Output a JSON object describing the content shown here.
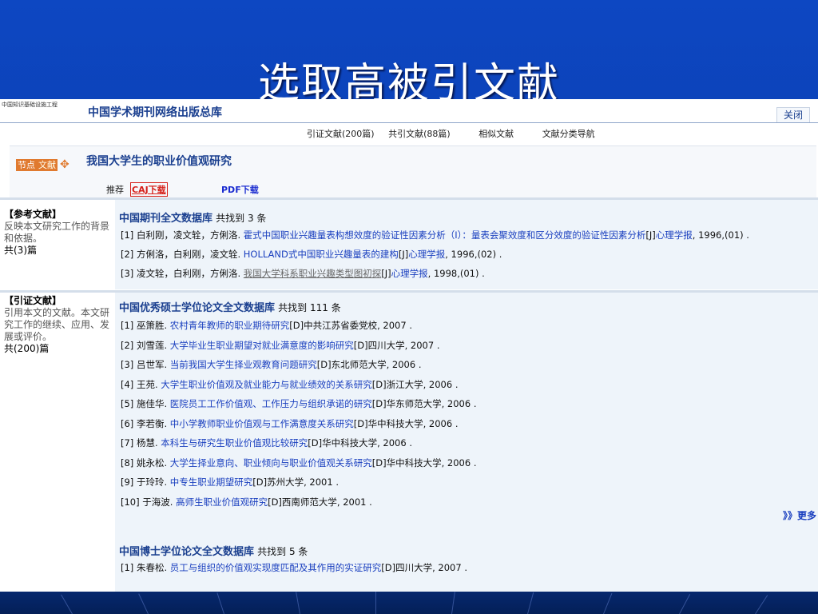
{
  "slide": {
    "title": "选取高被引文献"
  },
  "header": {
    "logo_text": "中国知识基础设施工程",
    "site_name": "中国学术期刊网络出版总库",
    "close_label": "关闭"
  },
  "nav": {
    "citing": "引证文献(200篇)",
    "co_citing": "共引文献(88篇)",
    "similar": "相似文献",
    "category": "文献分类导航"
  },
  "article": {
    "logo_a": "节点",
    "logo_b": "文献",
    "title": "我国大学生的职业价值观研究",
    "recommend": "推荐",
    "caj": "CAJ下载",
    "pdf": "PDF下载"
  },
  "references": {
    "side_heading": "【参考文献】",
    "side_desc": "反映本文研究工作的背景和依据。",
    "side_count": "共(3)篇",
    "db_name": "中国期刊全文数据库",
    "db_count": "共找到 3 条",
    "items": [
      {
        "idx": "[1]",
        "authors": "白利刚，凌文辁，方俐洛.",
        "title": "霍式中国职业兴趣量表构想效度的验证性因素分析（Ⅰ）：量表会聚效度和区分效度的验证性因素分析",
        "type": "[J]",
        "journal": "心理学报",
        "tail": ", 1996,(01) ."
      },
      {
        "idx": "[2]",
        "authors": "方俐洛，白利刚，凌文辁.",
        "title": "HOLLAND式中国职业兴趣量表的建构",
        "type": "[J]",
        "journal": "心理学报",
        "tail": ", 1996,(02) ."
      },
      {
        "idx": "[3]",
        "authors": "凌文辁，白利刚，方俐洛.",
        "title": "我国大学科系职业兴趣类型图初探",
        "type": "[J]",
        "journal": "心理学报",
        "tail": ", 1998,(01) ."
      }
    ]
  },
  "citations": {
    "side_heading": "【引证文献】",
    "side_desc": "引用本文的文献。本文研究工作的继续、应用、发展或评价。",
    "side_count": "共(200)篇",
    "master": {
      "db_name": "中国优秀硕士学位论文全文数据库",
      "db_count": "共找到 111 条",
      "items": [
        {
          "idx": "[1]",
          "authors": "巫箫胜.",
          "title": "农村青年教师的职业期待研究",
          "rest": "[D]中共江苏省委党校, 2007 ."
        },
        {
          "idx": "[2]",
          "authors": "刘雪莲.",
          "title": "大学毕业生职业期望对就业满意度的影响研究",
          "rest": "[D]四川大学, 2007 ."
        },
        {
          "idx": "[3]",
          "authors": "吕世军.",
          "title": "当前我国大学生择业观教育问题研究",
          "rest": "[D]东北师范大学, 2006 ."
        },
        {
          "idx": "[4]",
          "authors": "王苑.",
          "title": "大学生职业价值观及就业能力与就业绩效的关系研究",
          "rest": "[D]浙江大学, 2006 ."
        },
        {
          "idx": "[5]",
          "authors": "施佳华.",
          "title": "医院员工工作价值观、工作压力与组织承诺的研究",
          "rest": "[D]华东师范大学, 2006 ."
        },
        {
          "idx": "[6]",
          "authors": "李若衡.",
          "title": "中小学教师职业价值观与工作满意度关系研究",
          "rest": "[D]华中科技大学, 2006 ."
        },
        {
          "idx": "[7]",
          "authors": "杨慧.",
          "title": "本科生与研究生职业价值观比较研究",
          "rest": "[D]华中科技大学, 2006 ."
        },
        {
          "idx": "[8]",
          "authors": "姚永松.",
          "title": "大学生择业意向、职业倾向与职业价值观关系研究",
          "rest": "[D]华中科技大学, 2006 ."
        },
        {
          "idx": "[9]",
          "authors": "于玲玲.",
          "title": "中专生职业期望研究",
          "rest": "[D]苏州大学, 2001 ."
        },
        {
          "idx": "[10]",
          "authors": "于海波.",
          "title": "高师生职业价值观研究",
          "rest": "[D]西南师范大学, 2001 ."
        }
      ],
      "more": "》》更多"
    },
    "doctor": {
      "db_name": "中国博士学位论文全文数据库",
      "db_count": "共找到 5 条",
      "items": [
        {
          "idx": "[1]",
          "authors": "朱春松.",
          "title": "员工与组织的价值观实现度匹配及其作用的实证研究",
          "rest": "[D]四川大学, 2007 ."
        }
      ]
    }
  }
}
